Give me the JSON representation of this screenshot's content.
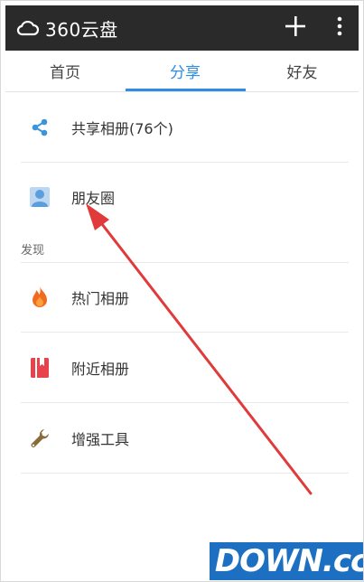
{
  "app": {
    "title": "360云盘"
  },
  "tabs": [
    {
      "label": "首页"
    },
    {
      "label": "分享",
      "active": true
    },
    {
      "label": "好友"
    }
  ],
  "list": {
    "items": [
      {
        "label": "共享相册(76个)",
        "icon": "share-icon"
      },
      {
        "label": "朋友圈",
        "icon": "person-icon"
      }
    ],
    "section_title": "发现",
    "discover_items": [
      {
        "label": "热门相册",
        "icon": "flame-icon"
      },
      {
        "label": "附近相册",
        "icon": "book-icon"
      },
      {
        "label": "增强工具",
        "icon": "wrench-icon"
      }
    ]
  },
  "watermark": {
    "text": "DOWN.cc"
  },
  "colors": {
    "topbar": "#2a2a2a",
    "accent": "#2f8de4",
    "annotation_arrow": "#e03a3a"
  }
}
